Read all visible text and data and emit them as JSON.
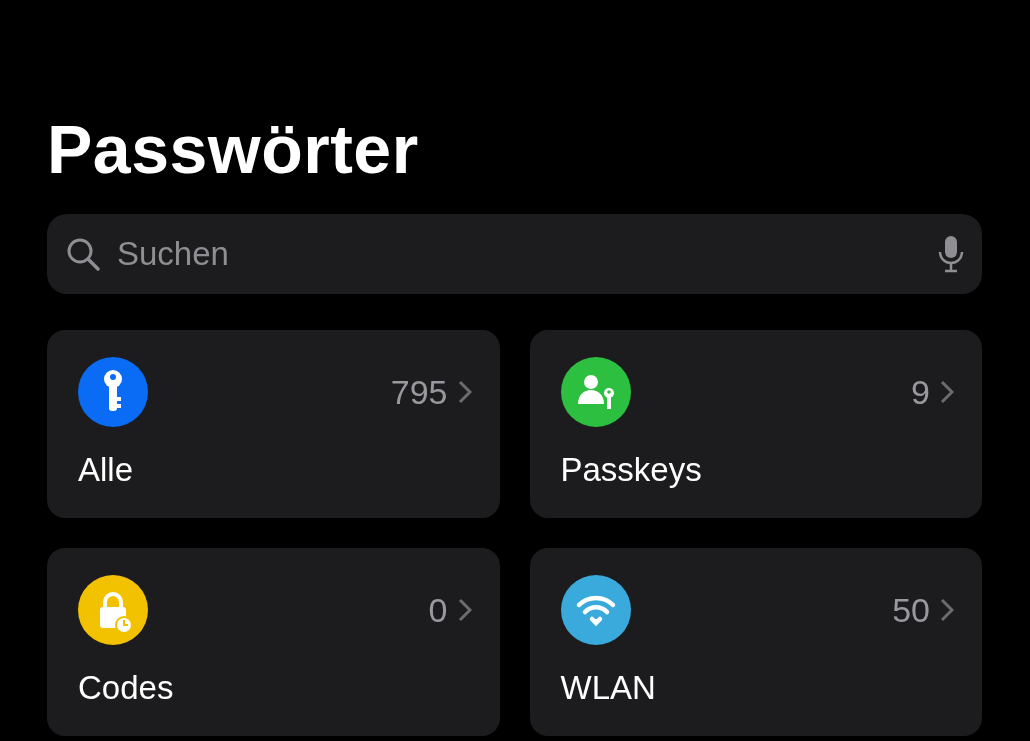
{
  "title": "Passwörter",
  "search": {
    "placeholder": "Suchen"
  },
  "categories": [
    {
      "kind": "key",
      "label": "Alle",
      "count": "795",
      "color": "#0a6cf5"
    },
    {
      "kind": "passkey",
      "label": "Passkeys",
      "count": "9",
      "color": "#2dbf3f"
    },
    {
      "kind": "codes",
      "label": "Codes",
      "count": "0",
      "color": "#f2c200"
    },
    {
      "kind": "wifi",
      "label": "WLAN",
      "count": "50",
      "color": "#3aa9dc"
    }
  ]
}
